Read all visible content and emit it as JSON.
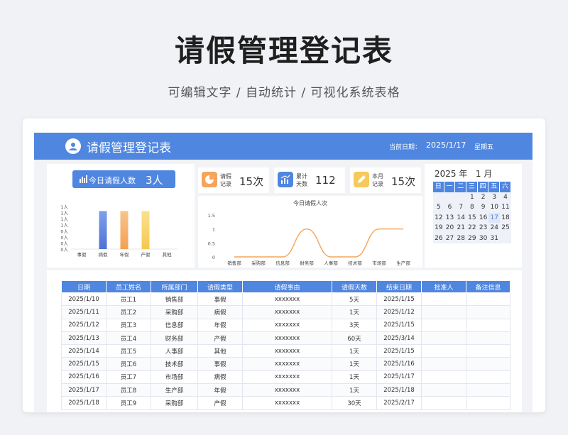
{
  "hero": {
    "title": "请假管理登记表",
    "subtitle": "可编辑文字 / 自动统计 / 可视化系统表格"
  },
  "header": {
    "title": "请假管理登记表",
    "date_label": "当前日期：",
    "date_value": "2025/1/17",
    "weekday": "星期五"
  },
  "today": {
    "label": "今日请假人数",
    "value": "3人"
  },
  "stats": [
    {
      "label": "请假记录",
      "value": "15次",
      "color": "#f5a45c"
    },
    {
      "label": "累计天数",
      "value": "112",
      "color": "#4f86e0"
    },
    {
      "label": "本月记录",
      "value": "15次",
      "color": "#f7c85a"
    }
  ],
  "colors": {
    "accent": "#4f86e0",
    "orange": "#f5a45c",
    "bar_blue": "#4f72d6",
    "bar_orange": "#f4a052",
    "bar_yellow": "#f5c84e"
  },
  "chart_data": [
    {
      "type": "bar",
      "categories": [
        "事假",
        "病假",
        "年假",
        "产假",
        "其他"
      ],
      "values": [
        0,
        1,
        1,
        1,
        0
      ],
      "yticks": [
        "1人",
        "1人",
        "1人",
        "1人",
        "0人",
        "0人",
        "0人",
        "0人"
      ],
      "ylim": [
        0,
        1.2
      ]
    },
    {
      "type": "line",
      "title": "今日请假人次",
      "categories": [
        "销售部",
        "采购部",
        "信息部",
        "财务部",
        "人事部",
        "技术部",
        "市场部",
        "生产部"
      ],
      "values": [
        0,
        0,
        0,
        1,
        0,
        0,
        1,
        1
      ],
      "yticks": [
        "1.5",
        "1",
        "0.5",
        "0"
      ],
      "ylim": [
        0,
        1.5
      ]
    }
  ],
  "calendar": {
    "year": "2025",
    "year_unit": "年",
    "month": "1",
    "month_unit": "月",
    "weekdays": [
      "日",
      "一",
      "二",
      "三",
      "四",
      "五",
      "六"
    ],
    "weeks": [
      [
        "",
        "",
        "",
        "1",
        "2",
        "3",
        "4"
      ],
      [
        "5",
        "6",
        "7",
        "8",
        "9",
        "10",
        "11"
      ],
      [
        "12",
        "13",
        "14",
        "15",
        "16",
        "17",
        "18"
      ],
      [
        "19",
        "20",
        "21",
        "22",
        "23",
        "24",
        "25"
      ],
      [
        "26",
        "27",
        "28",
        "29",
        "30",
        "31",
        ""
      ]
    ],
    "today": "17"
  },
  "table": {
    "headers": [
      "日期",
      "员工姓名",
      "所属部门",
      "请假类型",
      "请假事由",
      "请假天数",
      "结束日期",
      "批准人",
      "备注信息"
    ],
    "rows": [
      [
        "2025/1/10",
        "员工1",
        "销售部",
        "事假",
        "xxxxxxx",
        "5天",
        "2025/1/15",
        "",
        ""
      ],
      [
        "2025/1/11",
        "员工2",
        "采购部",
        "病假",
        "xxxxxxx",
        "1天",
        "2025/1/12",
        "",
        ""
      ],
      [
        "2025/1/12",
        "员工3",
        "信息部",
        "年假",
        "xxxxxxx",
        "3天",
        "2025/1/15",
        "",
        ""
      ],
      [
        "2025/1/13",
        "员工4",
        "财务部",
        "产假",
        "xxxxxxx",
        "60天",
        "2025/3/14",
        "",
        ""
      ],
      [
        "2025/1/14",
        "员工5",
        "人事部",
        "其他",
        "xxxxxxx",
        "1天",
        "2025/1/15",
        "",
        ""
      ],
      [
        "2025/1/15",
        "员工6",
        "技术部",
        "事假",
        "xxxxxxx",
        "1天",
        "2025/1/16",
        "",
        ""
      ],
      [
        "2025/1/16",
        "员工7",
        "市场部",
        "病假",
        "xxxxxxx",
        "1天",
        "2025/1/17",
        "",
        ""
      ],
      [
        "2025/1/17",
        "员工8",
        "生产部",
        "年假",
        "xxxxxxx",
        "1天",
        "2025/1/18",
        "",
        ""
      ],
      [
        "2025/1/18",
        "员工9",
        "采购部",
        "产假",
        "xxxxxxx",
        "30天",
        "2025/2/17",
        "",
        ""
      ]
    ]
  }
}
